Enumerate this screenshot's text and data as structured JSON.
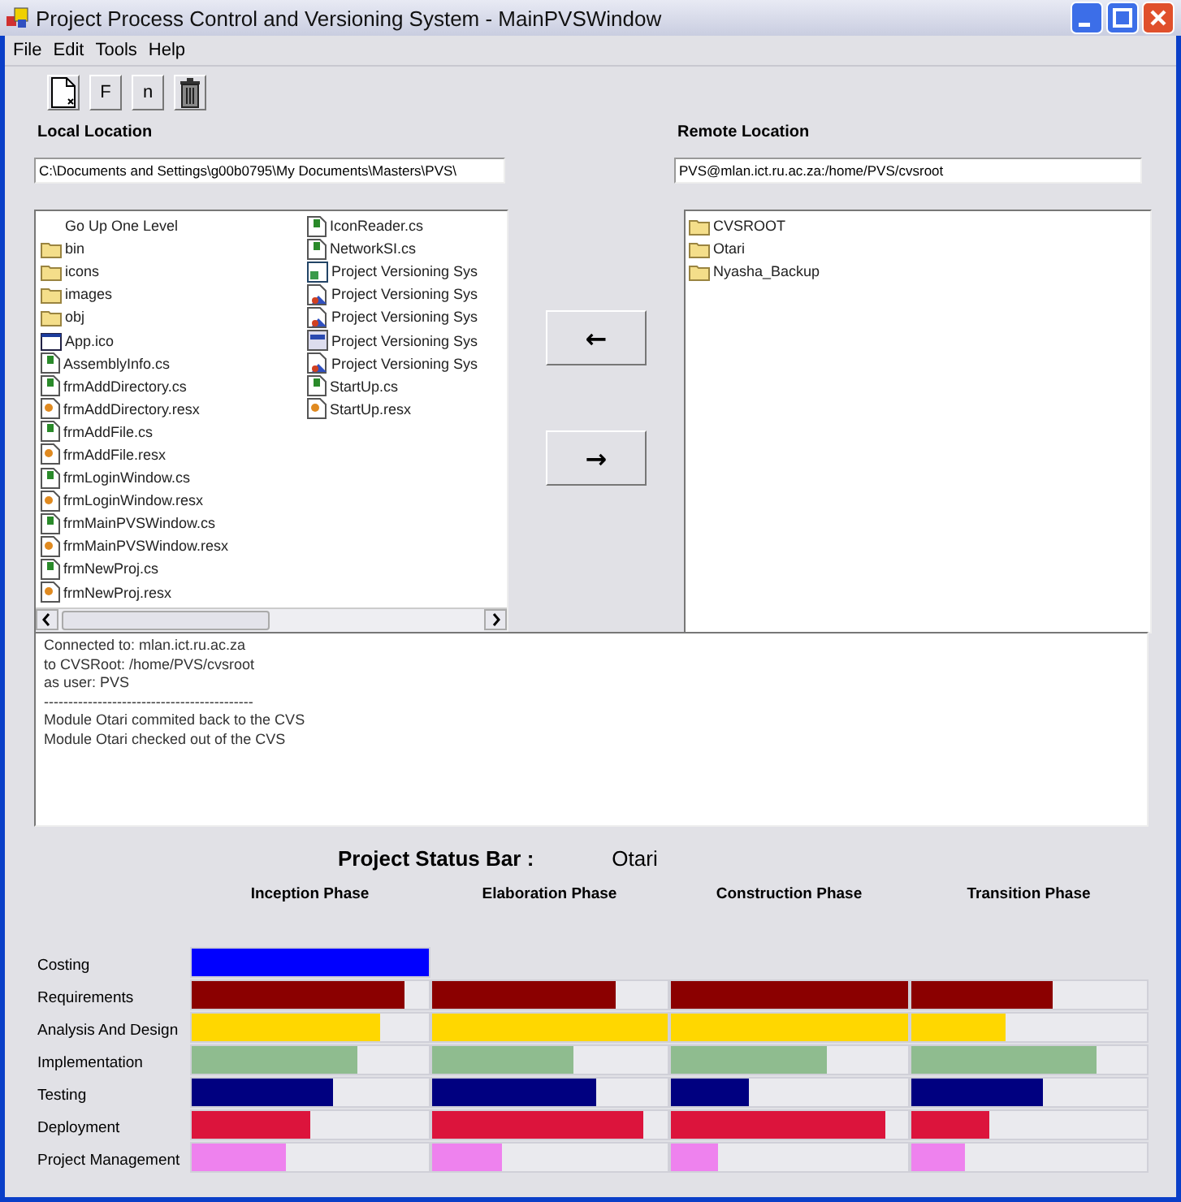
{
  "window": {
    "title": "Project Process Control and Versioning System - MainPVSWindow"
  },
  "menu": [
    "File",
    "Edit",
    "Tools",
    "Help"
  ],
  "toolbar": [
    {
      "kind": "new"
    },
    {
      "kind": "add-file",
      "glyph": "F"
    },
    {
      "kind": "add-dir",
      "glyph": "n"
    },
    {
      "kind": "delete"
    }
  ],
  "local": {
    "label": "Local Location",
    "path": "C:\\Documents and Settings\\g00b0795\\My Documents\\Masters\\PVS\\",
    "items": [
      {
        "kind": "up",
        "name": "Go Up One Level"
      },
      {
        "kind": "folder",
        "name": "bin"
      },
      {
        "kind": "folder",
        "name": "icons"
      },
      {
        "kind": "folder",
        "name": "images"
      },
      {
        "kind": "folder",
        "name": "obj"
      },
      {
        "kind": "ico",
        "name": "App.ico"
      },
      {
        "kind": "cs",
        "name": "AssemblyInfo.cs"
      },
      {
        "kind": "cs",
        "name": "frmAddDirectory.cs"
      },
      {
        "kind": "resx",
        "name": "frmAddDirectory.resx"
      },
      {
        "kind": "cs",
        "name": "frmAddFile.cs"
      },
      {
        "kind": "resx",
        "name": "frmAddFile.resx"
      },
      {
        "kind": "cs",
        "name": "frmLoginWindow.cs"
      },
      {
        "kind": "resx",
        "name": "frmLoginWindow.resx"
      },
      {
        "kind": "cs",
        "name": "frmMainPVSWindow.cs"
      },
      {
        "kind": "resx",
        "name": "frmMainPVSWindow.resx"
      },
      {
        "kind": "cs",
        "name": "frmNewProj.cs"
      },
      {
        "kind": "resx",
        "name": "frmNewProj.resx"
      },
      {
        "kind": "cs",
        "name": "IconReader.cs"
      },
      {
        "kind": "cs",
        "name": "NetworkSI.cs"
      },
      {
        "kind": "project",
        "name": "Project Versioning Sys"
      },
      {
        "kind": "doc",
        "name": "Project Versioning Sys"
      },
      {
        "kind": "doc",
        "name": "Project Versioning Sys"
      },
      {
        "kind": "window",
        "name": "Project Versioning Sys"
      },
      {
        "kind": "doc",
        "name": "Project Versioning Sys"
      },
      {
        "kind": "cs",
        "name": "StartUp.cs"
      },
      {
        "kind": "resx",
        "name": "StartUp.resx"
      }
    ]
  },
  "transfer_buttons": [
    {
      "glyph": "←"
    },
    {
      "glyph": "→"
    }
  ],
  "remote": {
    "label": "Remote Location",
    "path": "PVS@mlan.ict.ru.ac.za:/home/PVS/cvsroot",
    "items": [
      {
        "kind": "folder",
        "name": "CVSROOT"
      },
      {
        "kind": "folder",
        "name": "Otari"
      },
      {
        "kind": "folder",
        "name": "Nyasha_Backup"
      }
    ]
  },
  "log": [
    "Connected to: mlan.ict.ru.ac.za",
    "to CVSRoot: /home/PVS/cvsroot",
    "as user: PVS",
    "-------------------------------------------",
    "Module Otari commited back to the CVS",
    "Module Otari checked out of the CVS"
  ],
  "status": {
    "title": "Project Status Bar :",
    "project": "Otari",
    "phases": [
      "Inception Phase",
      "Elaboration Phase",
      "Construction Phase",
      "Transition Phase"
    ],
    "rows": [
      {
        "name": "Costing",
        "color": "#0000ff",
        "cells": [
          {
            "level": 1
          }
        ]
      },
      {
        "name": "Requirements",
        "color": "#8b0000",
        "cells": [
          {
            "level": 0.9
          },
          {
            "level": 0.78
          },
          {
            "level": 1
          },
          {
            "level": 0.6
          }
        ]
      },
      {
        "name": "Analysis And Design",
        "color": "#ffd700",
        "cells": [
          {
            "level": 0.8
          },
          {
            "level": 1
          },
          {
            "level": 1
          },
          {
            "level": 0.4
          }
        ]
      },
      {
        "name": "Implementation",
        "color": "#8fbc8f",
        "cells": [
          {
            "level": 0.7
          },
          {
            "level": 0.6
          },
          {
            "level": 0.66
          },
          {
            "level": 0.79
          }
        ]
      },
      {
        "name": "Testing",
        "color": "#000080",
        "cells": [
          {
            "level": 0.6
          },
          {
            "level": 0.7
          },
          {
            "level": 0.33
          },
          {
            "level": 0.56
          }
        ]
      },
      {
        "name": "Deployment",
        "color": "#dc143c",
        "cells": [
          {
            "level": 0.5
          },
          {
            "level": 0.9
          },
          {
            "level": 0.91
          },
          {
            "level": 0.33
          }
        ]
      },
      {
        "name": "Project Management",
        "color": "#ee82ee",
        "cells": [
          {
            "level": 0.4
          },
          {
            "level": 0.3
          },
          {
            "level": 0.2
          },
          {
            "level": 0.23
          }
        ]
      }
    ]
  }
}
